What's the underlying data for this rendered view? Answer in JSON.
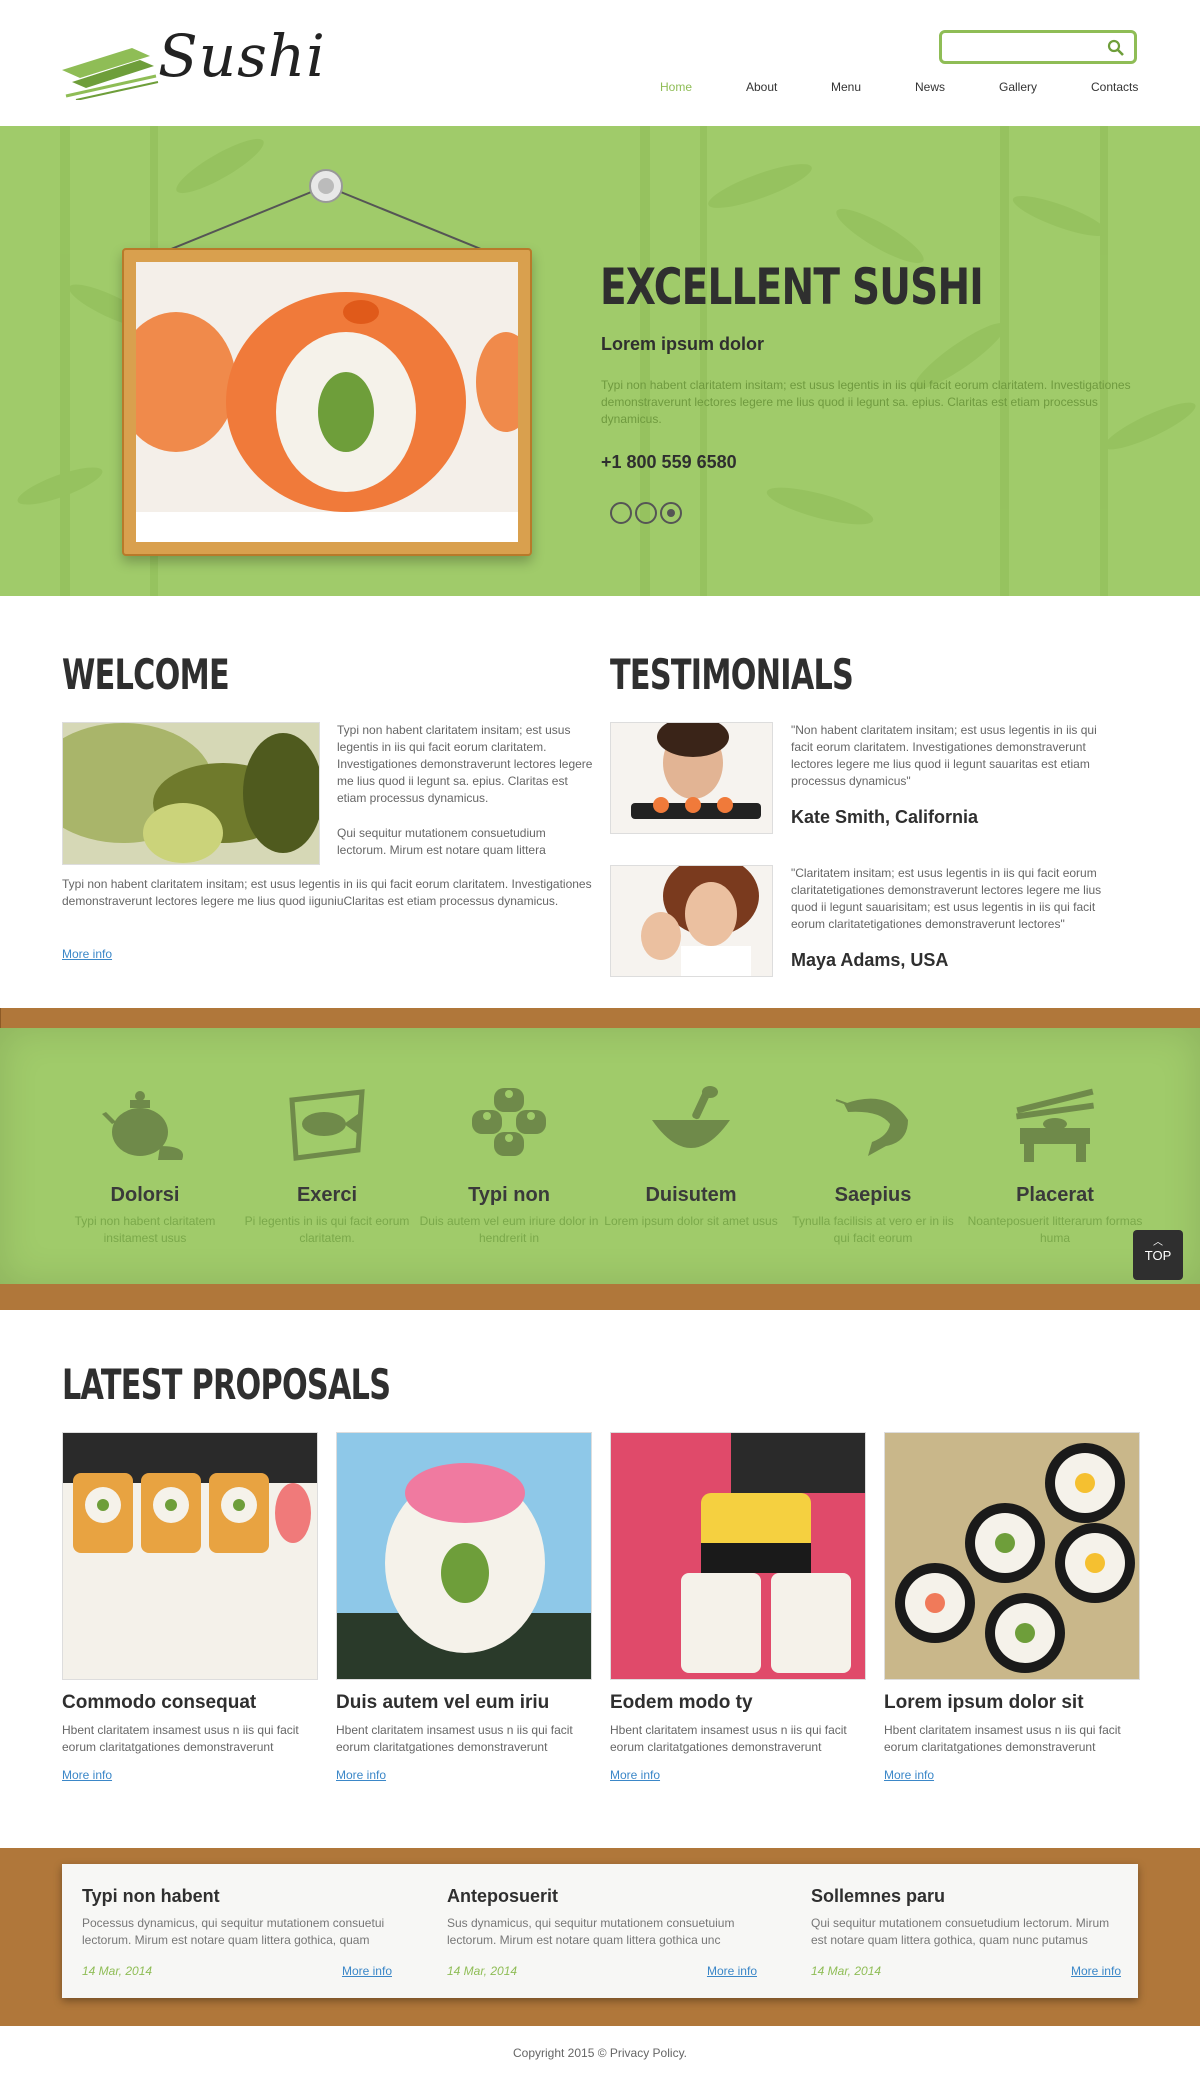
{
  "header": {
    "logo_text": "Sushi",
    "search": {
      "value": "",
      "placeholder": ""
    },
    "nav": [
      {
        "label": "Home",
        "active": true
      },
      {
        "label": "About"
      },
      {
        "label": "Menu"
      },
      {
        "label": "News"
      },
      {
        "label": "Gallery"
      },
      {
        "label": "Contacts"
      }
    ]
  },
  "hero": {
    "title": "EXCELLENT SUSHI",
    "subtitle": "Lorem ipsum dolor",
    "text": "Typi non habent claritatem insitam; est usus legentis in iis qui facit eorum claritatem. Investigationes demonstraverunt lectores legere me lius quod ii legunt sa. epius. Claritas est etiam processus dynamicus.",
    "phone": "+1 800 559 6580",
    "slides": 3,
    "active_slide": 3
  },
  "welcome": {
    "title": "WELCOME",
    "p1": "Typi non habent claritatem insitam; est usus legentis in iis qui facit eorum claritatem. Investigationes demonstraverunt lectores legere me lius quod ii legunt sa. epius. Claritas est etiam processus dynamicus.",
    "p2": "Qui sequitur mutationem consuetudium lectorum. Mirum est notare quam littera",
    "p3": "Typi non habent claritatem insitam; est usus legentis in iis qui facit eorum claritatem. Investigationes demonstraverunt lectores legere me lius quod iiguniuClaritas est etiam processus dynamicus.",
    "more": "More info"
  },
  "testimonials": {
    "title": "TESTIMONIALS",
    "items": [
      {
        "quote": "\"Non habent claritatem insitam; est usus legentis in iis qui facit eorum claritatem. Investigationes demonstraverunt lectores legere me lius quod ii legunt sauaritas est etiam processus dynamicus\"",
        "name": "Kate Smith, California"
      },
      {
        "quote": "\"Claritatem insitam; est usus legentis in iis qui facit eorum claritatetigationes demonstraverunt lectores legere me lius quod ii legunt sauarisitam; est usus legentis in iis qui facit eorum claritatetigationes demonstraverunt lectores\"",
        "name": "Maya Adams, USA"
      }
    ]
  },
  "features": [
    {
      "icon": "teapot-icon",
      "title": "Dolorsi",
      "text": "Typi non habent claritatem insitamest usus"
    },
    {
      "icon": "fish-plate-icon",
      "title": "Exerci",
      "text": "Pi legentis in iis qui facit eorum claritatem."
    },
    {
      "icon": "sushi-rolls-icon",
      "title": "Typi non",
      "text": "Duis autem vel eum iriure dolor in hendrerit in"
    },
    {
      "icon": "bowl-icon",
      "title": "Duisutem",
      "text": "Lorem ipsum dolor sit amet usus"
    },
    {
      "icon": "shrimp-icon",
      "title": "Saepius",
      "text": "Tynulla facilisis at vero er in iis qui facit eorum"
    },
    {
      "icon": "chopsticks-stand-icon",
      "title": "Placerat",
      "text": "Noanteposuerit litterarum formas huma"
    }
  ],
  "top_button": "TOP",
  "proposals": {
    "title": "LATEST PROPOSALS",
    "items": [
      {
        "title": "Commodo consequat",
        "text": "Hbent claritatem insamest usus n iis qui facit eorum claritatgationes demonstraverunt",
        "more": "More info"
      },
      {
        "title": "Duis autem vel eum iriu",
        "text": "Hbent claritatem insamest usus n iis qui facit eorum claritatgationes demonstraverunt",
        "more": "More info"
      },
      {
        "title": "Eodem modo ty",
        "text": "Hbent claritatem insamest usus n iis qui facit eorum claritatgationes demonstraverunt",
        "more": "More info"
      },
      {
        "title": "Lorem ipsum dolor sit",
        "text": "Hbent claritatem insamest usus n iis qui facit eorum claritatgationes demonstraverunt",
        "more": "More info"
      }
    ]
  },
  "news": [
    {
      "title": "Typi non habent",
      "text": "Pocessus dynamicus, qui sequitur mutationem consuetui lectorum. Mirum est notare quam littera gothica, quam",
      "date": "14 Mar, 2014",
      "more": "More info"
    },
    {
      "title": "Anteposuerit",
      "text": "Sus dynamicus, qui sequitur mutationem consuetuium lectorum. Mirum est notare quam littera gothica unc",
      "date": "14 Mar, 2014",
      "more": "More info"
    },
    {
      "title": "Sollemnes paru",
      "text": "Qui sequitur mutationem consuetudium lectorum. Mirum est notare quam littera gothica, quam nunc putamus",
      "date": "14 Mar, 2014",
      "more": "More info"
    }
  ],
  "footer": "Copyright 2015 © Privacy Policy.",
  "colors": {
    "accent": "#8fbd56",
    "green_bg": "#a0cb6a",
    "wood": "#b0773a",
    "link": "#3b87c8"
  }
}
